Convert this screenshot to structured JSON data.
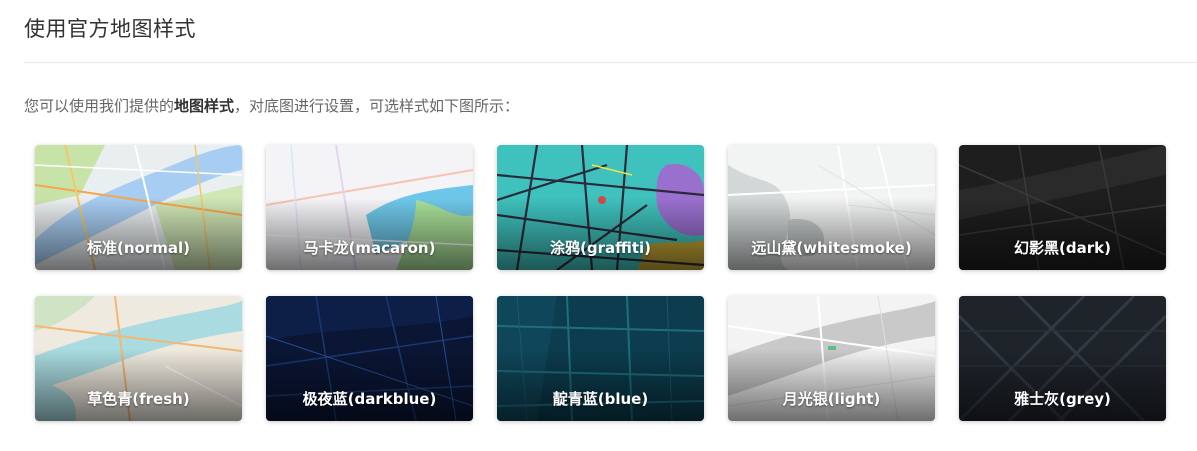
{
  "page": {
    "title": "使用官方地图样式",
    "intro_prefix": "您可以使用我们提供的",
    "intro_bold": "地图样式",
    "intro_suffix": "，对底图进行设置，可选样式如下图所示："
  },
  "styles": [
    {
      "label": "标准(normal)"
    },
    {
      "label": "马卡龙(macaron)"
    },
    {
      "label": "涂鸦(graffiti)"
    },
    {
      "label": "远山黛(whitesmoke)"
    },
    {
      "label": "幻影黑(dark)"
    },
    {
      "label": "草色青(fresh)"
    },
    {
      "label": "极夜蓝(darkblue)"
    },
    {
      "label": "靛青蓝(blue)"
    },
    {
      "label": "月光银(light)"
    },
    {
      "label": "雅士灰(grey)"
    }
  ]
}
